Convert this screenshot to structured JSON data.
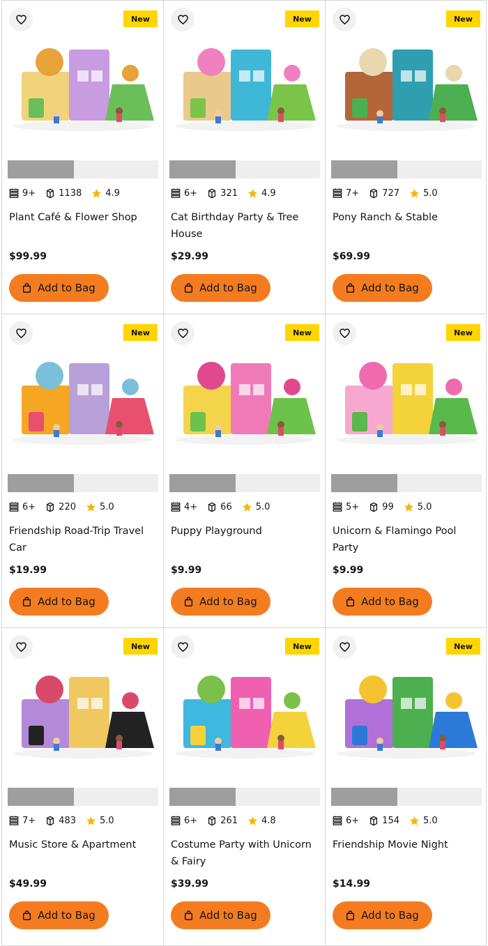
{
  "products": [
    {
      "title": "Plant Café & Flower Shop",
      "age": "9+",
      "pieces": "1138",
      "rating": "4.9",
      "price": "$99.99",
      "badge": "New",
      "add_label": "Add to Bag",
      "gallery_progress": 0.44,
      "image_colors": [
        "#f0d37a",
        "#c99be0",
        "#6bbf59",
        "#e8a23a"
      ]
    },
    {
      "title": "Cat Birthday Party & Tree House",
      "age": "6+",
      "pieces": "321",
      "rating": "4.9",
      "price": "$29.99",
      "badge": "New",
      "add_label": "Add to Bag",
      "gallery_progress": 0.44,
      "image_colors": [
        "#e9c98c",
        "#3fb8d8",
        "#7bc44a",
        "#f080c0"
      ]
    },
    {
      "title": "Pony Ranch & Stable",
      "age": "7+",
      "pieces": "727",
      "rating": "5.0",
      "price": "$69.99",
      "badge": "New",
      "add_label": "Add to Bag",
      "gallery_progress": 0.44,
      "image_colors": [
        "#b5653a",
        "#2f9fb0",
        "#4caf50",
        "#e9d7b0"
      ]
    },
    {
      "title": "Friendship Road-Trip Travel Car",
      "age": "6+",
      "pieces": "220",
      "rating": "5.0",
      "price": "$19.99",
      "badge": "New",
      "add_label": "Add to Bag",
      "gallery_progress": 0.44,
      "image_colors": [
        "#f5a623",
        "#b8a0d8",
        "#e8506e",
        "#7ac0d8"
      ]
    },
    {
      "title": "Puppy Playground",
      "age": "4+",
      "pieces": "66",
      "rating": "5.0",
      "price": "$9.99",
      "badge": "New",
      "add_label": "Add to Bag",
      "gallery_progress": 0.44,
      "image_colors": [
        "#f4d44a",
        "#f07ab8",
        "#6cc24a",
        "#e04890"
      ]
    },
    {
      "title": "Unicorn & Flamingo Pool Party",
      "age": "5+",
      "pieces": "99",
      "rating": "5.0",
      "price": "$9.99",
      "badge": "New",
      "add_label": "Add to Bag",
      "gallery_progress": 0.44,
      "image_colors": [
        "#f7a8d0",
        "#f4d23a",
        "#59b94a",
        "#f06ab0"
      ]
    },
    {
      "title": "Music Store & Apartment",
      "age": "7+",
      "pieces": "483",
      "rating": "5.0",
      "price": "$49.99",
      "badge": "New",
      "add_label": "Add to Bag",
      "gallery_progress": 0.44,
      "image_colors": [
        "#b48ad8",
        "#f0c860",
        "#222222",
        "#d94a6a"
      ]
    },
    {
      "title": "Costume Party with Unicorn & Fairy",
      "age": "6+",
      "pieces": "261",
      "rating": "4.8",
      "price": "$39.99",
      "badge": "New",
      "add_label": "Add to Bag",
      "gallery_progress": 0.44,
      "image_colors": [
        "#3fb8e0",
        "#f060b0",
        "#f4d23a",
        "#7ac04a"
      ]
    },
    {
      "title": "Friendship Movie Night",
      "age": "6+",
      "pieces": "154",
      "rating": "5.0",
      "price": "$14.99",
      "badge": "New",
      "add_label": "Add to Bag",
      "gallery_progress": 0.44,
      "image_colors": [
        "#b070d8",
        "#4caf50",
        "#2c7ad8",
        "#f4c430"
      ]
    }
  ],
  "icons": {
    "wishlist": "heart-icon",
    "age": "age-blocks-icon",
    "pieces": "brick-icon",
    "rating": "star-icon",
    "bag": "shopping-bag-icon"
  },
  "colors": {
    "badge": "#ffd500",
    "add_button": "#f47c20",
    "star": "#f5b50a",
    "gallery_track": "#eeeeee",
    "gallery_fill": "#9e9e9e"
  }
}
